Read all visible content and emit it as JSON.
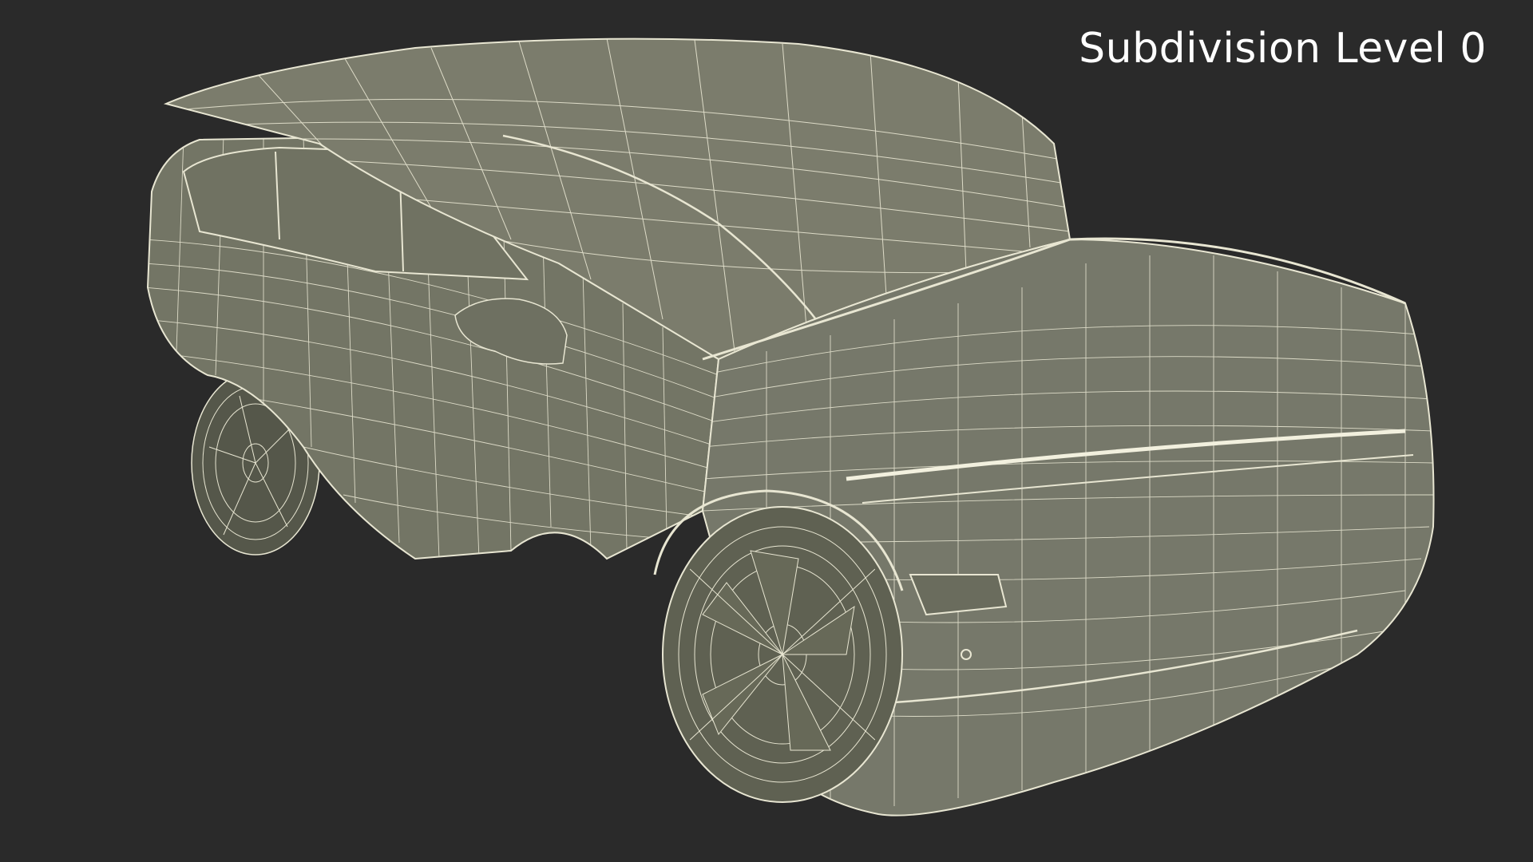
{
  "render_label": "Subdivision Level 0",
  "colors": {
    "background": "#2a2a2a",
    "body": "#7b7c6c",
    "body_shade": "#666858",
    "body_light": "#8b8c7b",
    "wire": "#e8e6d2",
    "tire": "#5f6152",
    "label": "#ffffff"
  }
}
